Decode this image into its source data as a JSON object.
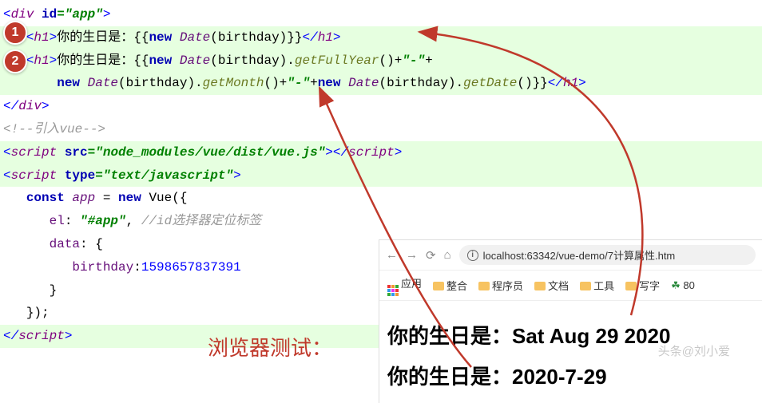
{
  "badges": {
    "b1": "1",
    "b2": "2"
  },
  "code": {
    "div_open_1": "<",
    "div_open_2": "div ",
    "div_attr": "id",
    "div_val": "=\"app\"",
    "div_open_close": ">",
    "h1a": {
      "open1": "<",
      "open2": "h1",
      "open3": ">",
      "text1": "你的生日是：{{",
      "kw_new": "new ",
      "date": "Date",
      "args": "(birthday)}}",
      "close1": "</",
      "close2": "h1",
      "close3": ">"
    },
    "h1b": {
      "open1": "<",
      "open2": "h1",
      "open3": ">",
      "text1": "你的生日是：{{",
      "kw_new1": "new ",
      "date1": "Date",
      "args1": "(birthday).",
      "m1": "getFullYear",
      "after1": "()+",
      "dash1": "\"-\"",
      "plus1": "+",
      "indent": "       ",
      "kw_new2": "new ",
      "date2": "Date",
      "args2": "(birthday).",
      "m2": "getMonth",
      "after2": "()+",
      "dash2": "\"-\"",
      "plus2": "+",
      "kw_new3": "new ",
      "date3": "Date",
      "args3": "(birthday).",
      "m3": "getDate",
      "after3": "()}}",
      "close1": "</",
      "close2": "h1",
      "close3": ">"
    },
    "div_close1": "</",
    "div_close2": "div",
    "div_close3": ">",
    "cmt_vue": "<!--引入vue-->",
    "script1": {
      "open1": "<",
      "open2": "script ",
      "attr": "src",
      "val": "=\"node_modules/vue/dist/vue.js\"",
      "open3": ">",
      "close1": "</",
      "close2": "script",
      "close3": ">"
    },
    "script2": {
      "open1": "<",
      "open2": "script ",
      "attr": "type",
      "val": "=\"text/javascript\"",
      "open3": ">"
    },
    "js": {
      "const": "const ",
      "app": "app",
      "eq": " = ",
      "newkw": "new ",
      "vue": "Vue({",
      "el_k": "el",
      "el_c": ": ",
      "el_v": "\"#app\"",
      "el_comma": ", ",
      "el_cmt": "//id选择器定位标签",
      "data_k": "data",
      "data_c": ": {",
      "bday_k": "birthday",
      "bday_c": ":",
      "bday_v": "1598657837391",
      "close_brace": "}",
      "close_call": "});"
    },
    "script_end": {
      "close1": "</",
      "close2": "script",
      "close3": ">"
    }
  },
  "test_label": "浏览器测试：",
  "browser": {
    "url": "localhost:63342/vue-demo/7计算属性.htm",
    "bookmarks": {
      "apps": "应用",
      "b1": "整合",
      "b2": "程序员",
      "b3": "文档",
      "b4": "工具",
      "b5": "写字",
      "b6": "80"
    },
    "out1": "你的生日是：Sat Aug 29 2020",
    "out2": "你的生日是：2020-7-29"
  },
  "watermark": "头条@刘小爱"
}
